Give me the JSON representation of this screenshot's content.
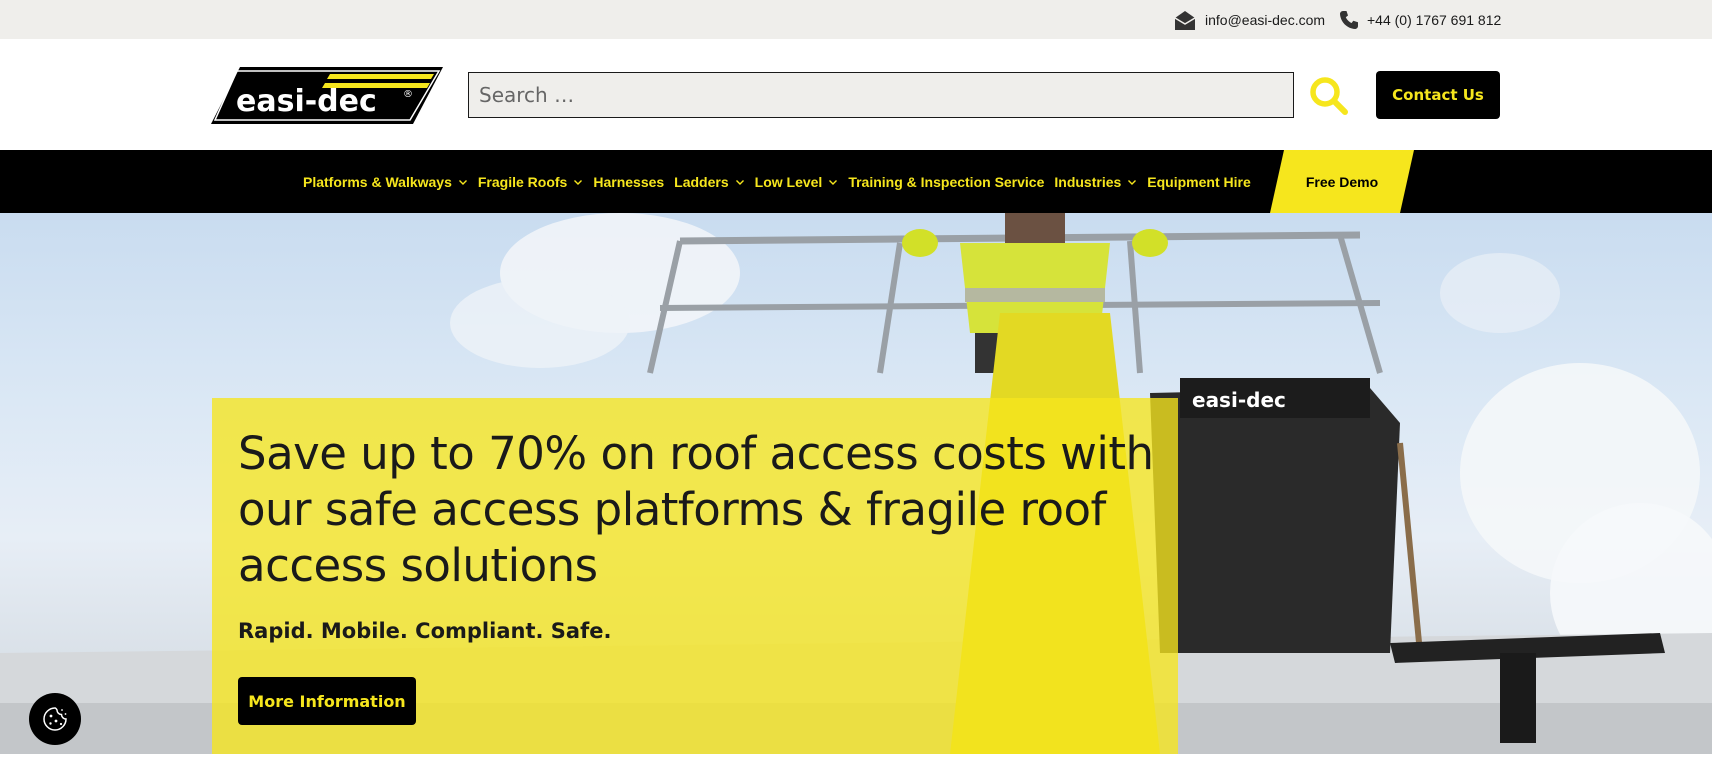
{
  "topbar": {
    "email": "info@easi-dec.com",
    "phone": "+44 (0) 1767 691 812",
    "email_icon": "envelope-icon",
    "phone_icon": "phone-icon"
  },
  "header": {
    "logo_text": "easi-dec",
    "logo_mark": "®",
    "search_placeholder": "Search …",
    "search_icon": "search-icon",
    "contact_label": "Contact Us"
  },
  "nav": {
    "items": [
      {
        "label": "Platforms & Walkways",
        "has_dropdown": true
      },
      {
        "label": "Fragile Roofs",
        "has_dropdown": true
      },
      {
        "label": "Harnesses",
        "has_dropdown": false
      },
      {
        "label": "Ladders",
        "has_dropdown": true
      },
      {
        "label": "Low Level",
        "has_dropdown": true
      },
      {
        "label": "Training & Inspection Service",
        "has_dropdown": false
      },
      {
        "label": "Industries",
        "has_dropdown": true
      },
      {
        "label": "Equipment Hire",
        "has_dropdown": false
      }
    ],
    "demo_label": "Free Demo"
  },
  "hero": {
    "heading": "Save up to 70% on roof access costs with our safe access platforms & fragile roof access solutions",
    "subheading": "Rapid. Mobile. Compliant. Safe.",
    "cta_label": "More Information"
  },
  "cookie": {
    "icon": "cookie-icon"
  },
  "colors": {
    "brand_yellow": "#f6e61d",
    "brand_black": "#000000",
    "topbar_bg": "#efeeeb"
  }
}
